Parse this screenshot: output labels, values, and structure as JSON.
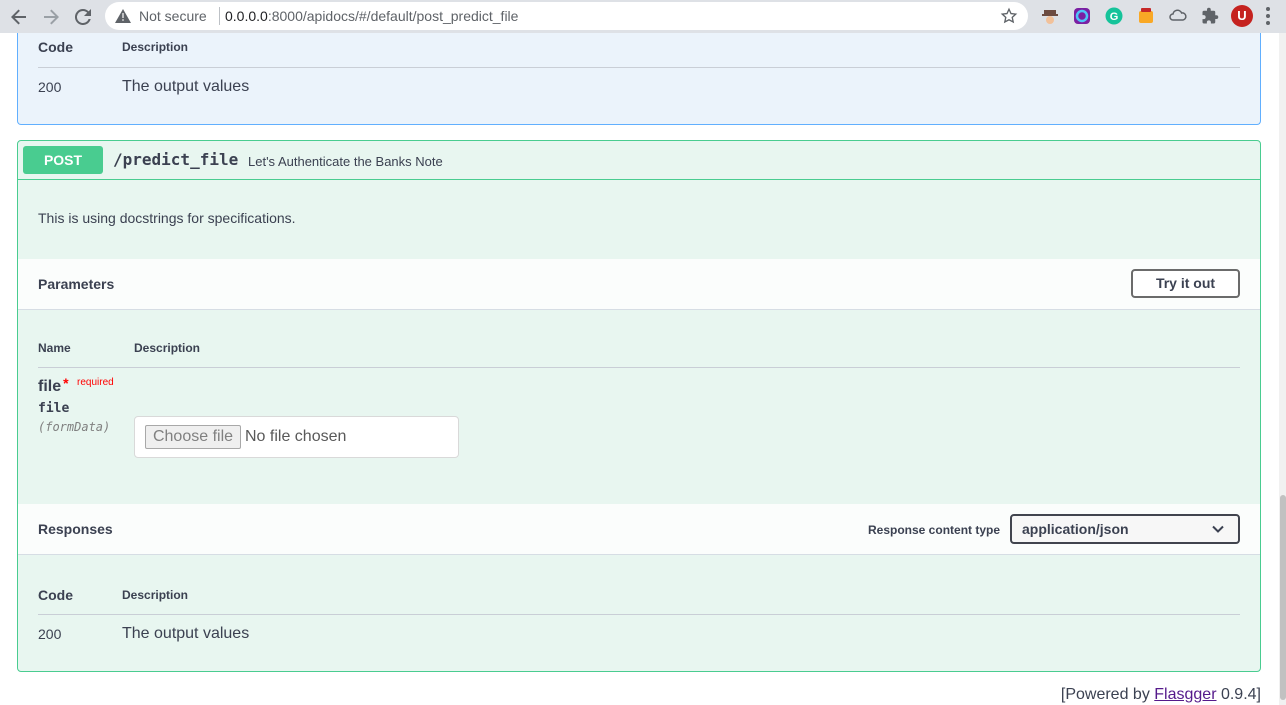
{
  "browser": {
    "security_label": "Not secure",
    "url_host": "0.0.0.0",
    "url_rest": ":8000/apidocs/#/default/post_predict_file",
    "avatar_letter": "U"
  },
  "previous_op": {
    "col_code": "Code",
    "col_description": "Description",
    "code": "200",
    "description": "The output values"
  },
  "operation": {
    "method": "POST",
    "path": "/predict_file",
    "summary": "Let's Authenticate the Banks Note",
    "description": "This is using docstrings for specifications.",
    "parameters": {
      "title": "Parameters",
      "try_label": "Try it out",
      "col_name": "Name",
      "col_description": "Description",
      "param": {
        "name": "file",
        "star": "*",
        "required": "required",
        "type": "file",
        "in": "(formData)",
        "choose_label": "Choose file",
        "none_label": "No file chosen"
      }
    },
    "responses": {
      "title": "Responses",
      "content_type_label": "Response content type",
      "content_type": "application/json",
      "col_code": "Code",
      "col_description": "Description",
      "code": "200",
      "description": "The output values"
    }
  },
  "footer": {
    "prefix": "[Powered by ",
    "link": "Flasgger",
    "suffix": " 0.9.4]"
  },
  "colors": {
    "post": "#49cc90",
    "get_border": "#61affe"
  }
}
